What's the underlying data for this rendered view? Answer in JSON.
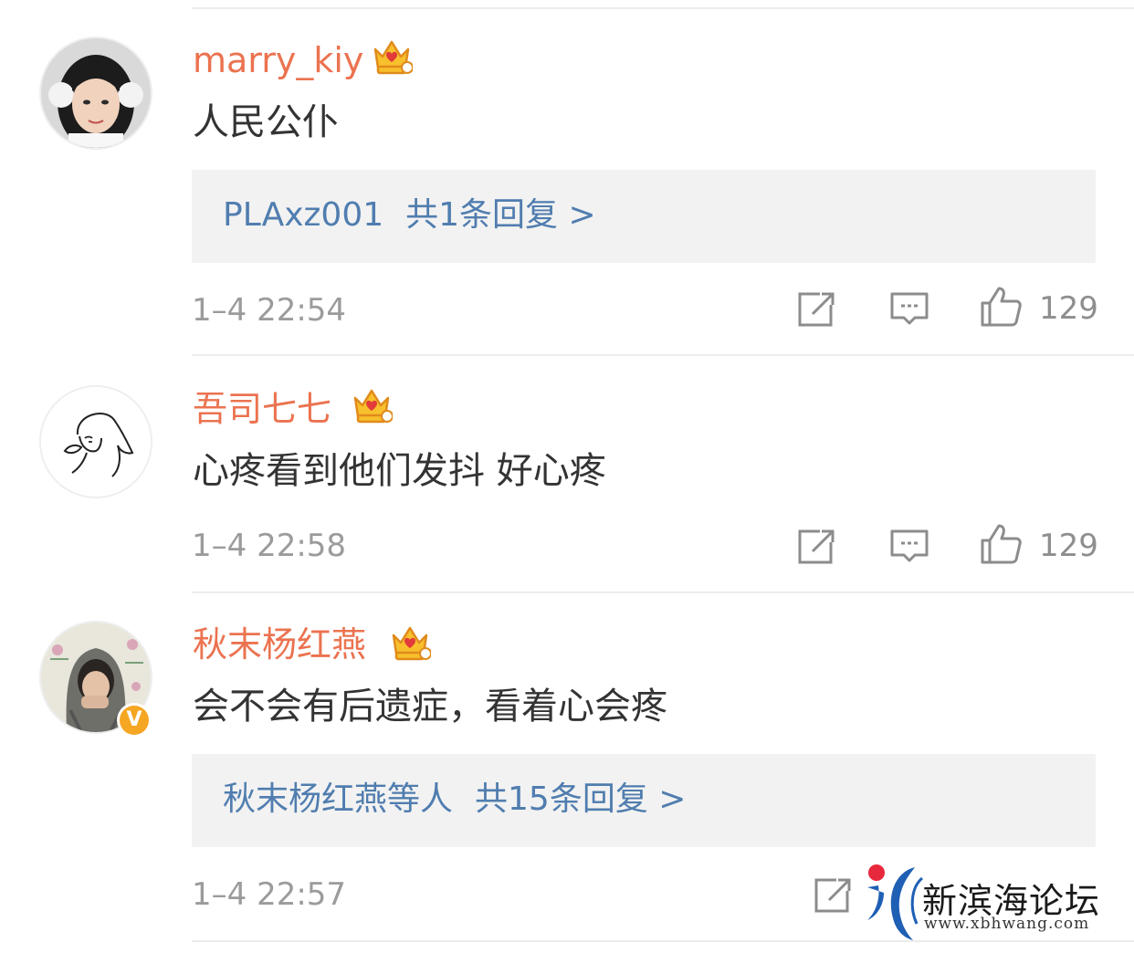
{
  "comments": [
    {
      "username": "marry_kiy",
      "badge_icon": "crown-badge-icon",
      "content": "人民公仆",
      "reply_preview": {
        "author": "PLAxz001",
        "count_text": "共1条回复 >"
      },
      "time": "1–4 22:54",
      "like_count": "129"
    },
    {
      "username": "吾司七七",
      "badge_icon": "crown-badge-icon",
      "content": "心疼看到他们发抖  好心疼",
      "time": "1–4 22:58",
      "like_count": "129"
    },
    {
      "username": "秋末杨红燕",
      "badge_icon": "crown-badge-icon",
      "verified_badge": "V",
      "content": "会不会有后遗症，看着心会疼",
      "reply_preview": {
        "author": "秋末杨红燕等人",
        "count_text": "共15条回复 >"
      },
      "time": "1–4 22:57"
    }
  ],
  "watermark": {
    "title": "新滨海论坛",
    "url": "www.xbhwang.com"
  },
  "colors": {
    "username": "#eb7350",
    "link": "#507daf",
    "meta": "#9b9b9b",
    "reply_bg": "#f2f2f2"
  }
}
